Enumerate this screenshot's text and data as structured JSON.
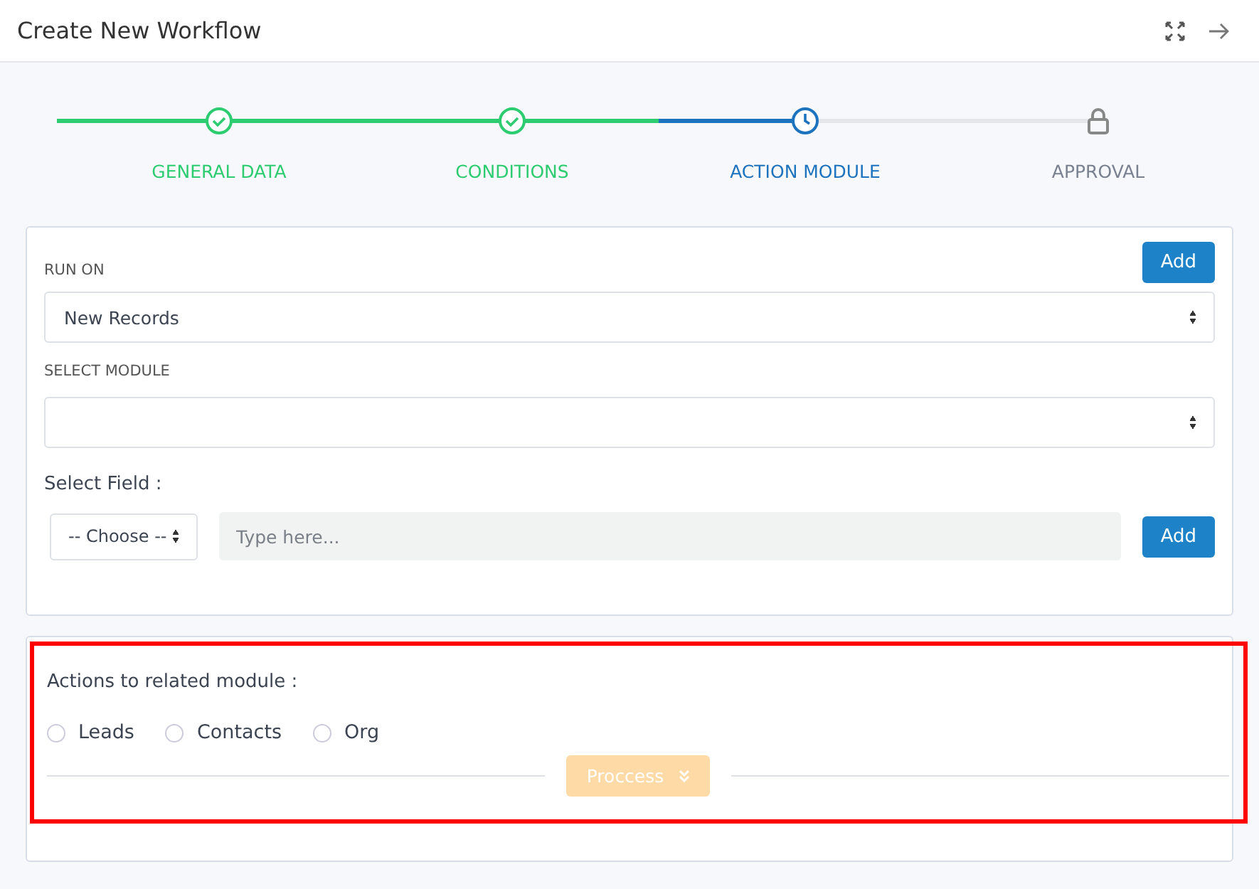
{
  "window": {
    "title": "Create New Workflow"
  },
  "steps": [
    {
      "label": "GENERAL DATA",
      "kind": "done"
    },
    {
      "label": "CONDITIONS",
      "kind": "done"
    },
    {
      "label": "ACTION MODULE",
      "kind": "current"
    },
    {
      "label": "APPROVAL",
      "kind": "locked"
    }
  ],
  "run_on": {
    "label": "RUN ON",
    "value": "New Records",
    "add": "Add"
  },
  "select_module": {
    "label": "SELECT MODULE"
  },
  "select_field": {
    "label": "Select Field :",
    "choose": "-- Choose --",
    "placeholder": "Type here...",
    "add": "Add"
  },
  "related": {
    "label": "Actions to related module :",
    "options": [
      {
        "label": "Leads",
        "selected": false
      },
      {
        "label": "Contacts",
        "selected": false
      },
      {
        "label": "Org",
        "selected": false
      }
    ],
    "process": "Proccess",
    "process_disabled": true
  }
}
